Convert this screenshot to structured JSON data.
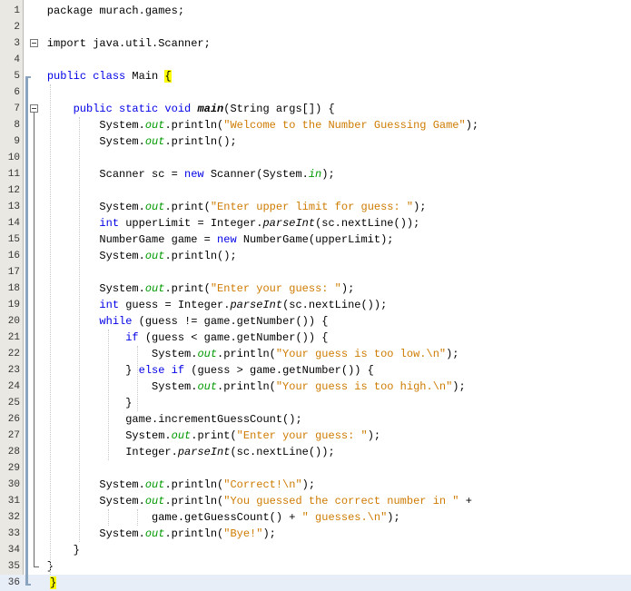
{
  "editor": {
    "language": "java",
    "current_line": 36,
    "lines": [
      {
        "n": "1",
        "tokens": [
          {
            "t": "    package murach.games;",
            "c": ""
          }
        ]
      },
      {
        "n": "2",
        "tokens": []
      },
      {
        "n": "3",
        "tokens": [
          {
            "t": "    import java.util.Scanner;",
            "c": ""
          }
        ]
      },
      {
        "n": "4",
        "tokens": []
      },
      {
        "n": "5",
        "tokens": [
          {
            "t": "    ",
            "c": ""
          },
          {
            "t": "public class",
            "c": "kw"
          },
          {
            "t": " Main ",
            "c": ""
          },
          {
            "t": "{",
            "c": "brace-hl"
          }
        ]
      },
      {
        "n": "6",
        "tokens": []
      },
      {
        "n": "7",
        "tokens": [
          {
            "t": "        ",
            "c": ""
          },
          {
            "t": "public static void",
            "c": "kw"
          },
          {
            "t": " ",
            "c": ""
          },
          {
            "t": "main",
            "c": "bold it"
          },
          {
            "t": "(String args[]) {",
            "c": ""
          }
        ]
      },
      {
        "n": "8",
        "tokens": [
          {
            "t": "            System.",
            "c": ""
          },
          {
            "t": "out",
            "c": "fld"
          },
          {
            "t": ".println(",
            "c": ""
          },
          {
            "t": "\"Welcome to the Number Guessing Game\"",
            "c": "str"
          },
          {
            "t": ");",
            "c": ""
          }
        ]
      },
      {
        "n": "9",
        "tokens": [
          {
            "t": "            System.",
            "c": ""
          },
          {
            "t": "out",
            "c": "fld"
          },
          {
            "t": ".println();",
            "c": ""
          }
        ]
      },
      {
        "n": "10",
        "tokens": []
      },
      {
        "n": "11",
        "tokens": [
          {
            "t": "            Scanner sc = ",
            "c": ""
          },
          {
            "t": "new",
            "c": "kw"
          },
          {
            "t": " Scanner(System.",
            "c": ""
          },
          {
            "t": "in",
            "c": "fld"
          },
          {
            "t": ");",
            "c": ""
          }
        ]
      },
      {
        "n": "12",
        "tokens": []
      },
      {
        "n": "13",
        "tokens": [
          {
            "t": "            System.",
            "c": ""
          },
          {
            "t": "out",
            "c": "fld"
          },
          {
            "t": ".print(",
            "c": ""
          },
          {
            "t": "\"Enter upper limit for guess: \"",
            "c": "str"
          },
          {
            "t": ");",
            "c": ""
          }
        ]
      },
      {
        "n": "14",
        "tokens": [
          {
            "t": "            ",
            "c": ""
          },
          {
            "t": "int",
            "c": "kw"
          },
          {
            "t": " upperLimit = Integer.",
            "c": ""
          },
          {
            "t": "parseInt",
            "c": "it"
          },
          {
            "t": "(sc.nextLine());",
            "c": ""
          }
        ]
      },
      {
        "n": "15",
        "tokens": [
          {
            "t": "            NumberGame game = ",
            "c": ""
          },
          {
            "t": "new",
            "c": "kw"
          },
          {
            "t": " NumberGame(upperLimit);",
            "c": ""
          }
        ]
      },
      {
        "n": "16",
        "tokens": [
          {
            "t": "            System.",
            "c": ""
          },
          {
            "t": "out",
            "c": "fld"
          },
          {
            "t": ".println();",
            "c": ""
          }
        ]
      },
      {
        "n": "17",
        "tokens": []
      },
      {
        "n": "18",
        "tokens": [
          {
            "t": "            System.",
            "c": ""
          },
          {
            "t": "out",
            "c": "fld"
          },
          {
            "t": ".print(",
            "c": ""
          },
          {
            "t": "\"Enter your guess: \"",
            "c": "str"
          },
          {
            "t": ");",
            "c": ""
          }
        ]
      },
      {
        "n": "19",
        "tokens": [
          {
            "t": "            ",
            "c": ""
          },
          {
            "t": "int",
            "c": "kw"
          },
          {
            "t": " guess = Integer.",
            "c": ""
          },
          {
            "t": "parseInt",
            "c": "it"
          },
          {
            "t": "(sc.nextLine());",
            "c": ""
          }
        ]
      },
      {
        "n": "20",
        "tokens": [
          {
            "t": "            ",
            "c": ""
          },
          {
            "t": "while",
            "c": "kw"
          },
          {
            "t": " (guess != game.getNumber()) {",
            "c": ""
          }
        ]
      },
      {
        "n": "21",
        "tokens": [
          {
            "t": "                ",
            "c": ""
          },
          {
            "t": "if",
            "c": "kw"
          },
          {
            "t": " (guess < game.getNumber()) {",
            "c": ""
          }
        ]
      },
      {
        "n": "22",
        "tokens": [
          {
            "t": "                    System.",
            "c": ""
          },
          {
            "t": "out",
            "c": "fld"
          },
          {
            "t": ".println(",
            "c": ""
          },
          {
            "t": "\"Your guess is too low.\\n\"",
            "c": "str"
          },
          {
            "t": ");",
            "c": ""
          }
        ]
      },
      {
        "n": "23",
        "tokens": [
          {
            "t": "                } ",
            "c": ""
          },
          {
            "t": "else if",
            "c": "kw"
          },
          {
            "t": " (guess > game.getNumber()) {",
            "c": ""
          }
        ]
      },
      {
        "n": "24",
        "tokens": [
          {
            "t": "                    System.",
            "c": ""
          },
          {
            "t": "out",
            "c": "fld"
          },
          {
            "t": ".println(",
            "c": ""
          },
          {
            "t": "\"Your guess is too high.\\n\"",
            "c": "str"
          },
          {
            "t": ");",
            "c": ""
          }
        ]
      },
      {
        "n": "25",
        "tokens": [
          {
            "t": "                }",
            "c": ""
          }
        ]
      },
      {
        "n": "26",
        "tokens": [
          {
            "t": "                game.incrementGuessCount();",
            "c": ""
          }
        ]
      },
      {
        "n": "27",
        "tokens": [
          {
            "t": "                System.",
            "c": ""
          },
          {
            "t": "out",
            "c": "fld"
          },
          {
            "t": ".print(",
            "c": ""
          },
          {
            "t": "\"Enter your guess: \"",
            "c": "str"
          },
          {
            "t": ");",
            "c": ""
          }
        ]
      },
      {
        "n": "28",
        "tokens": [
          {
            "t": "                Integer.",
            "c": ""
          },
          {
            "t": "parseInt",
            "c": "it"
          },
          {
            "t": "(sc.nextLine());",
            "c": ""
          }
        ]
      },
      {
        "n": "29",
        "tokens": []
      },
      {
        "n": "30",
        "tokens": [
          {
            "t": "            System.",
            "c": ""
          },
          {
            "t": "out",
            "c": "fld"
          },
          {
            "t": ".println(",
            "c": ""
          },
          {
            "t": "\"Correct!\\n\"",
            "c": "str"
          },
          {
            "t": ");",
            "c": ""
          }
        ]
      },
      {
        "n": "31",
        "tokens": [
          {
            "t": "            System.",
            "c": ""
          },
          {
            "t": "out",
            "c": "fld"
          },
          {
            "t": ".println(",
            "c": ""
          },
          {
            "t": "\"You guessed the correct number in \"",
            "c": "str"
          },
          {
            "t": " +",
            "c": ""
          }
        ]
      },
      {
        "n": "32",
        "tokens": [
          {
            "t": "                    game.getGuessCount() + ",
            "c": ""
          },
          {
            "t": "\" guesses.\\n\"",
            "c": "str"
          },
          {
            "t": ");",
            "c": ""
          }
        ]
      },
      {
        "n": "33",
        "tokens": [
          {
            "t": "            System.",
            "c": ""
          },
          {
            "t": "out",
            "c": "fld"
          },
          {
            "t": ".println(",
            "c": ""
          },
          {
            "t": "\"Bye!\"",
            "c": "str"
          },
          {
            "t": ");",
            "c": ""
          }
        ]
      },
      {
        "n": "34",
        "tokens": [
          {
            "t": "        }",
            "c": ""
          }
        ]
      },
      {
        "n": "35",
        "tokens": [
          {
            "t": "    }",
            "c": ""
          }
        ]
      },
      {
        "n": "36",
        "tokens": [
          {
            "t": "",
            "c": ""
          },
          {
            "t": "}",
            "c": "brace-hl"
          }
        ]
      }
    ],
    "fold_markers": [
      {
        "line": 3,
        "icon": "collapse-icon"
      },
      {
        "line": 7,
        "icon": "collapse-icon"
      }
    ]
  }
}
